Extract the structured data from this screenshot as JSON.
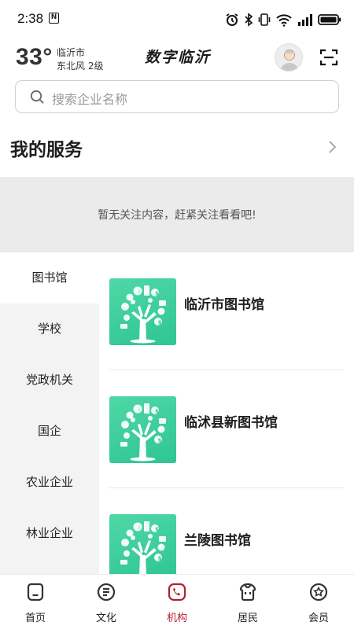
{
  "status_bar": {
    "time": "2:38",
    "notification_badge": "N",
    "icons": [
      "alarm-icon",
      "bluetooth-icon",
      "vibrate-icon",
      "wifi-icon",
      "signal-icon",
      "battery-icon"
    ]
  },
  "header": {
    "temperature": "33°",
    "city": "临沂市",
    "wind": "东北风  2级",
    "app_title": "数字临沂",
    "avatar_icon": "user-avatar-icon",
    "scan_icon": "scan-icon"
  },
  "search": {
    "placeholder": "搜索企业名称"
  },
  "services": {
    "title": "我的服务",
    "empty_text": "暂无关注内容，赶紧关注看看吧!"
  },
  "categories": [
    {
      "label": "图书馆",
      "active": true
    },
    {
      "label": "学校",
      "active": false
    },
    {
      "label": "党政机关",
      "active": false
    },
    {
      "label": "国企",
      "active": false
    },
    {
      "label": "农业企业",
      "active": false
    },
    {
      "label": "林业企业",
      "active": false
    }
  ],
  "institutions": [
    {
      "name": "临沂市图书馆",
      "thumb_icon": "knowledge-tree-icon"
    },
    {
      "name": "临沭县新图书馆",
      "thumb_icon": "knowledge-tree-icon"
    },
    {
      "name": "兰陵图书馆",
      "thumb_icon": "knowledge-tree-icon"
    }
  ],
  "bottom_nav": [
    {
      "label": "首页",
      "icon": "home-icon",
      "active": false
    },
    {
      "label": "文化",
      "icon": "culture-icon",
      "active": false
    },
    {
      "label": "机构",
      "icon": "institution-icon",
      "active": true
    },
    {
      "label": "居民",
      "icon": "resident-icon",
      "active": false
    },
    {
      "label": "会员",
      "icon": "member-icon",
      "active": false
    }
  ],
  "colors": {
    "accent": "#b51f2f",
    "thumb_green": "#3ccf9c",
    "notice_bg": "#ebebeb",
    "sidebar_bg": "#f3f3f3"
  }
}
